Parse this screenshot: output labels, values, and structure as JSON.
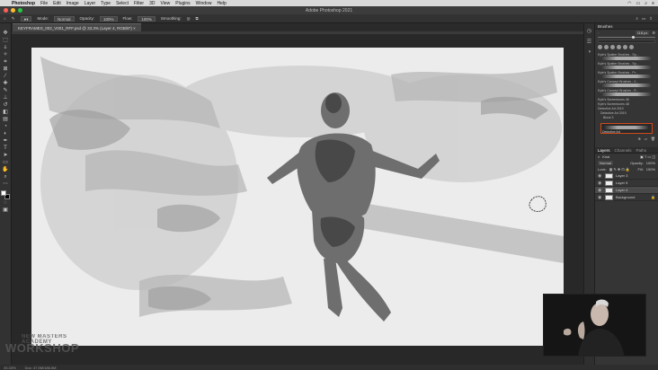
{
  "menubar": {
    "app_name": "Photoshop",
    "items": [
      "File",
      "Edit",
      "Image",
      "Layer",
      "Type",
      "Select",
      "Filter",
      "3D",
      "View",
      "Plugins",
      "Window",
      "Help"
    ]
  },
  "window": {
    "title": "Adobe Photoshop 2021"
  },
  "options": {
    "mode_label": "Mode:",
    "mode_value": "Normal",
    "opacity_label": "Opacity:",
    "opacity_value": "100%",
    "flow_label": "Flow:",
    "flow_value": "100%",
    "smoothing_label": "Smoothing:"
  },
  "document": {
    "tab_label": "KEYFRAMES_002_V001_RFF.psd @ 33.3% (Layer 4, RGB/8*) ×"
  },
  "brushes_panel": {
    "title": "Brushes",
    "size_value": "118 px",
    "items": [
      "Kyle's Spatter Brushes - Sp...",
      "Kyle's Spatter Brushes - Sp...",
      "Kyle's Spatter Brushes - Pr...",
      "Kyle's Concept Brushes - V...",
      "Kyle's Concept Brushes - R...",
      "Kyle's Screentones 46",
      "Kyle's Screentones 48"
    ],
    "groups": [
      "Detective Art 2019",
      "Detective Art 2019",
      "Block 3"
    ],
    "selected_brush": "Detective Art"
  },
  "layers_panel": {
    "tabs": [
      "Layers",
      "Channels",
      "Paths"
    ],
    "kind_label": "Kind",
    "blend_value": "Normal",
    "opacity_label": "Opacity:",
    "opacity_value": "100%",
    "lock_label": "Lock:",
    "fill_label": "Fill:",
    "fill_value": "100%",
    "layers": [
      {
        "name": "Layer 3",
        "selected": false
      },
      {
        "name": "Layer 5",
        "selected": false
      },
      {
        "name": "Layer 4",
        "selected": true
      },
      {
        "name": "Background",
        "selected": false
      }
    ]
  },
  "statusbar": {
    "zoom": "33.33%",
    "doc_info": "Doc: 47.5M/186.5M"
  },
  "watermark": {
    "main": "WORKSHOP",
    "sub": "NEW MASTERS ACADEMY"
  },
  "colors": {
    "accent": "#d04a1a",
    "canvas_bg": "#ececec",
    "workspace": "#282828"
  }
}
